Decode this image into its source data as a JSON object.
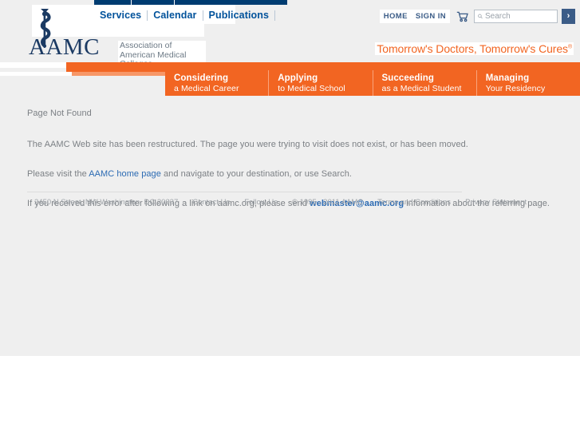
{
  "header": {
    "logo": {
      "mark_icon": "rod-of-asclepius-icon",
      "wordmark": "AAMC",
      "tagline_line1": "Association of",
      "tagline_line2": "American Medical Colleges"
    },
    "topnav": [
      {
        "label": "Services"
      },
      {
        "label": "Calendar"
      },
      {
        "label": "Publications"
      }
    ],
    "tools": {
      "home_label": "HOME",
      "signin_label": "SIGN IN",
      "cart_icon": "shopping-cart-icon",
      "search_icon": "search-icon",
      "search_value": "",
      "search_placeholder": "Search",
      "search_go_label": "›"
    },
    "tagline": "Tomorrow's Doctors, Tomorrow's Cures",
    "tagline_mark": "®"
  },
  "tabs": [
    {
      "title": "Considering",
      "sub": "a Medical Career"
    },
    {
      "title": "Applying",
      "sub": "to Medical School"
    },
    {
      "title": "Succeeding",
      "sub": "as a Medical Student"
    },
    {
      "title": "Managing",
      "sub": "Your Residency"
    }
  ],
  "main": {
    "heading": "Page Not Found",
    "paragraph_restructured": "The AAMC Web site has been restructured. The page you were trying to visit does not exist, or has been moved.",
    "paragraph_visit_pre": "Please visit the ",
    "home_link_label": "AAMC home page",
    "paragraph_visit_post": " and navigate to your destination, or use Search.",
    "paragraph_error_pre": "If you received this error after following a link on aamc.org, please send ",
    "webmaster_link_label": "webmaster@aamc.org",
    "paragraph_error_post": " information about the referring page."
  },
  "footer": {
    "address": "2450 N Street, NW Washington, DC 20037",
    "contact": "Contact Us",
    "follow": "Follow Us",
    "copyright": "© 1995 - 2011 AAMC",
    "terms": "Terms and Conditions",
    "privacy": "Privacy Statement"
  },
  "colors": {
    "orange": "#f26522",
    "navy": "#003c71",
    "link_blue": "#2c6bb3",
    "nav_blue": "#00529b",
    "gray_bg": "#efefef",
    "text_gray": "#7c8085"
  }
}
